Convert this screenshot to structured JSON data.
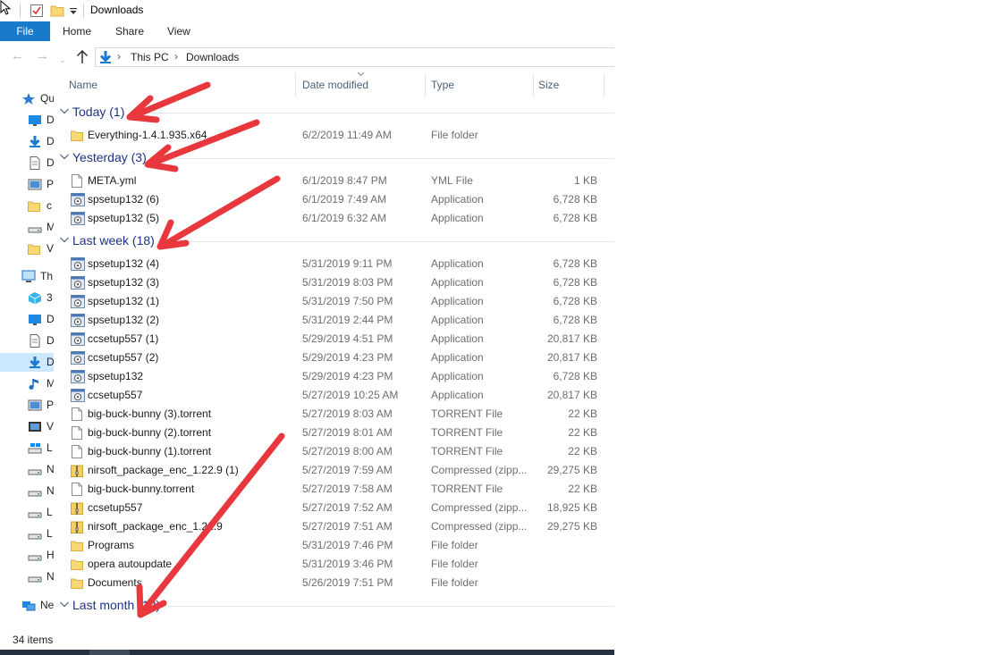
{
  "window": {
    "title": "Downloads"
  },
  "ribbon": {
    "tabs": [
      "File",
      "Home",
      "Share",
      "View"
    ]
  },
  "address": {
    "crumbs": [
      "This PC",
      "Downloads"
    ]
  },
  "nav": {
    "items": [
      {
        "label": "Qu",
        "icon": "star-icon"
      },
      {
        "label": "D",
        "icon": "desktop-icon"
      },
      {
        "label": "D",
        "icon": "download-icon"
      },
      {
        "label": "D",
        "icon": "document-icon"
      },
      {
        "label": "P",
        "icon": "picture-icon"
      },
      {
        "label": "c",
        "icon": "folder-icon"
      },
      {
        "label": "M",
        "icon": "drive-icon"
      },
      {
        "label": "V",
        "icon": "folder-icon"
      },
      {
        "label": "Th",
        "icon": "computer-icon"
      },
      {
        "label": "3",
        "icon": "cube-icon"
      },
      {
        "label": "D",
        "icon": "desktop-icon"
      },
      {
        "label": "D",
        "icon": "document-icon"
      },
      {
        "label": "D",
        "icon": "download-icon"
      },
      {
        "label": "M",
        "icon": "music-icon"
      },
      {
        "label": "P",
        "icon": "picture-icon"
      },
      {
        "label": "V",
        "icon": "video-icon"
      },
      {
        "label": "L",
        "icon": "windows-drive-icon"
      },
      {
        "label": "N",
        "icon": "drive-icon"
      },
      {
        "label": "N",
        "icon": "drive-icon"
      },
      {
        "label": "L",
        "icon": "drive-icon"
      },
      {
        "label": "L",
        "icon": "drive-icon"
      },
      {
        "label": "H",
        "icon": "drive-icon"
      },
      {
        "label": "N",
        "icon": "drive-icon"
      },
      {
        "label": "Ne",
        "icon": "network-icon"
      }
    ]
  },
  "columns": {
    "name": "Name",
    "date": "Date modified",
    "type": "Type",
    "size": "Size"
  },
  "groups": [
    {
      "title": "Today (1)",
      "files": [
        {
          "name": "Everything-1.4.1.935.x64",
          "date": "6/2/2019 11:49 AM",
          "type": "File folder",
          "size": "",
          "icon": "folder-icon"
        }
      ]
    },
    {
      "title": "Yesterday (3)",
      "files": [
        {
          "name": "META.yml",
          "date": "6/1/2019 8:47 PM",
          "type": "YML File",
          "size": "1 KB",
          "icon": "file-icon"
        },
        {
          "name": "spsetup132 (6)",
          "date": "6/1/2019 7:49 AM",
          "type": "Application",
          "size": "6,728 KB",
          "icon": "installer-icon"
        },
        {
          "name": "spsetup132 (5)",
          "date": "6/1/2019 6:32 AM",
          "type": "Application",
          "size": "6,728 KB",
          "icon": "installer-icon"
        }
      ]
    },
    {
      "title": "Last week (18)",
      "files": [
        {
          "name": "spsetup132 (4)",
          "date": "5/31/2019 9:11 PM",
          "type": "Application",
          "size": "6,728 KB",
          "icon": "installer-icon"
        },
        {
          "name": "spsetup132 (3)",
          "date": "5/31/2019 8:03 PM",
          "type": "Application",
          "size": "6,728 KB",
          "icon": "installer-icon"
        },
        {
          "name": "spsetup132 (1)",
          "date": "5/31/2019 7:50 PM",
          "type": "Application",
          "size": "6,728 KB",
          "icon": "installer-icon"
        },
        {
          "name": "spsetup132 (2)",
          "date": "5/31/2019 2:44 PM",
          "type": "Application",
          "size": "6,728 KB",
          "icon": "installer-icon"
        },
        {
          "name": "ccsetup557 (1)",
          "date": "5/29/2019 4:51 PM",
          "type": "Application",
          "size": "20,817 KB",
          "icon": "installer-icon"
        },
        {
          "name": "ccsetup557 (2)",
          "date": "5/29/2019 4:23 PM",
          "type": "Application",
          "size": "20,817 KB",
          "icon": "installer-icon"
        },
        {
          "name": "spsetup132",
          "date": "5/29/2019 4:23 PM",
          "type": "Application",
          "size": "6,728 KB",
          "icon": "installer-icon"
        },
        {
          "name": "ccsetup557",
          "date": "5/27/2019 10:25 AM",
          "type": "Application",
          "size": "20,817 KB",
          "icon": "installer-icon"
        },
        {
          "name": "big-buck-bunny (3).torrent",
          "date": "5/27/2019 8:03 AM",
          "type": "TORRENT File",
          "size": "22 KB",
          "icon": "file-icon"
        },
        {
          "name": "big-buck-bunny (2).torrent",
          "date": "5/27/2019 8:01 AM",
          "type": "TORRENT File",
          "size": "22 KB",
          "icon": "file-icon"
        },
        {
          "name": "big-buck-bunny (1).torrent",
          "date": "5/27/2019 8:00 AM",
          "type": "TORRENT File",
          "size": "22 KB",
          "icon": "file-icon"
        },
        {
          "name": "nirsoft_package_enc_1.22.9 (1)",
          "date": "5/27/2019 7:59 AM",
          "type": "Compressed (zipp...",
          "size": "29,275 KB",
          "icon": "zip-icon"
        },
        {
          "name": "big-buck-bunny.torrent",
          "date": "5/27/2019 7:58 AM",
          "type": "TORRENT File",
          "size": "22 KB",
          "icon": "file-icon"
        },
        {
          "name": "ccsetup557",
          "date": "5/27/2019 7:52 AM",
          "type": "Compressed (zipp...",
          "size": "18,925 KB",
          "icon": "zip-icon"
        },
        {
          "name": "nirsoft_package_enc_1.22.9",
          "date": "5/27/2019 7:51 AM",
          "type": "Compressed (zipp...",
          "size": "29,275 KB",
          "icon": "zip-icon"
        },
        {
          "name": "Programs",
          "date": "5/31/2019 7:46 PM",
          "type": "File folder",
          "size": "",
          "icon": "folder-icon"
        },
        {
          "name": "opera autoupdate",
          "date": "5/31/2019 3:46 PM",
          "type": "File folder",
          "size": "",
          "icon": "folder-icon"
        },
        {
          "name": "Documents",
          "date": "5/26/2019 7:51 PM",
          "type": "File folder",
          "size": "",
          "icon": "folder-icon"
        }
      ]
    },
    {
      "title": "Last month (12)",
      "files": []
    }
  ],
  "status": {
    "item_count": "34 items"
  },
  "colors": {
    "accent": "#1979ca",
    "group_title": "#1e3287",
    "arrow": "#e8383d",
    "selection": "#cce8ff"
  }
}
